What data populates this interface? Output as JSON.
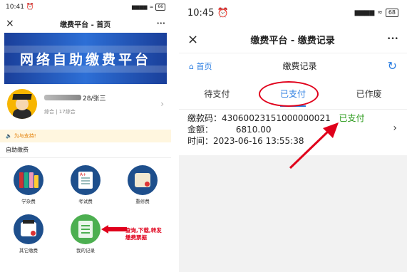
{
  "left": {
    "status_time": "10:41",
    "status_signal": "▆▆▆▆",
    "battery": "66",
    "nav": {
      "close": "×",
      "title": "缴费平台 - 首页",
      "more": "•••"
    },
    "banner_text": "网络自助缴费平台",
    "profile": {
      "name_suffix": "28/张三",
      "sub": "综合 | 17综合",
      "chevron": "›"
    },
    "notice": "为与支持!",
    "section_title": "自助缴费",
    "grid": [
      {
        "label": "学杂费",
        "icon": "books-icon"
      },
      {
        "label": "考试费",
        "icon": "exam-paper-icon"
      },
      {
        "label": "重修费",
        "icon": "scroll-icon"
      },
      {
        "label": "其它缴费",
        "icon": "certificate-icon"
      },
      {
        "label": "我的记录",
        "icon": "record-list-icon"
      }
    ],
    "annotation": {
      "line1": "查询,下载,转发",
      "line2": "缴费票据"
    }
  },
  "right": {
    "status_time": "10:45",
    "status_signal": "▆▆▆▆",
    "battery": "68",
    "nav": {
      "close": "×",
      "title": "缴费平台 - 缴费记录",
      "more": "•••"
    },
    "subbar": {
      "home": "⌂ 首页",
      "title": "缴费记录",
      "refresh": "↻"
    },
    "tabs": [
      "待支付",
      "已支付",
      "已作废"
    ],
    "record": {
      "code_label": "缴款码：",
      "code": "4306002315100000002​1",
      "status": "已支付",
      "amount_label": "金额：",
      "amount": "6810.00",
      "time_label": "时间：",
      "time": "2023-06-16 13:55:38",
      "chevron": "›"
    }
  },
  "colors": {
    "accent": "#2a7de1",
    "paid": "#2a9a1a",
    "annotation": "#e0001b",
    "banner": "#1a3f9a"
  }
}
